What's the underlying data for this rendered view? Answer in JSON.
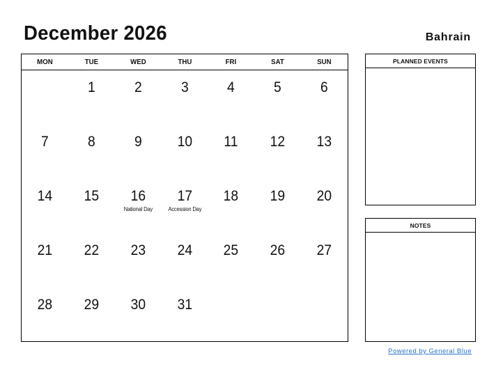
{
  "header": {
    "title": "December 2026",
    "country": "Bahrain"
  },
  "calendar": {
    "weekdays": [
      "MON",
      "TUE",
      "WED",
      "THU",
      "FRI",
      "SAT",
      "SUN"
    ],
    "weeks": [
      [
        {
          "day": ""
        },
        {
          "day": "1"
        },
        {
          "day": "2"
        },
        {
          "day": "3"
        },
        {
          "day": "4"
        },
        {
          "day": "5"
        },
        {
          "day": "6"
        }
      ],
      [
        {
          "day": "7"
        },
        {
          "day": "8"
        },
        {
          "day": "9"
        },
        {
          "day": "10"
        },
        {
          "day": "11"
        },
        {
          "day": "12"
        },
        {
          "day": "13"
        }
      ],
      [
        {
          "day": "14"
        },
        {
          "day": "15"
        },
        {
          "day": "16",
          "event": "National Day"
        },
        {
          "day": "17",
          "event": "Accession Day"
        },
        {
          "day": "18"
        },
        {
          "day": "19"
        },
        {
          "day": "20"
        }
      ],
      [
        {
          "day": "21"
        },
        {
          "day": "22"
        },
        {
          "day": "23"
        },
        {
          "day": "24"
        },
        {
          "day": "25"
        },
        {
          "day": "26"
        },
        {
          "day": "27"
        }
      ],
      [
        {
          "day": "28"
        },
        {
          "day": "29"
        },
        {
          "day": "30"
        },
        {
          "day": "31"
        },
        {
          "day": ""
        },
        {
          "day": ""
        },
        {
          "day": ""
        }
      ]
    ]
  },
  "sidebar": {
    "planned_events_label": "PLANNED EVENTS",
    "notes_label": "NOTES"
  },
  "footer": {
    "powered_by": "Powered by General Blue",
    "link_color": "#2a73c7"
  }
}
